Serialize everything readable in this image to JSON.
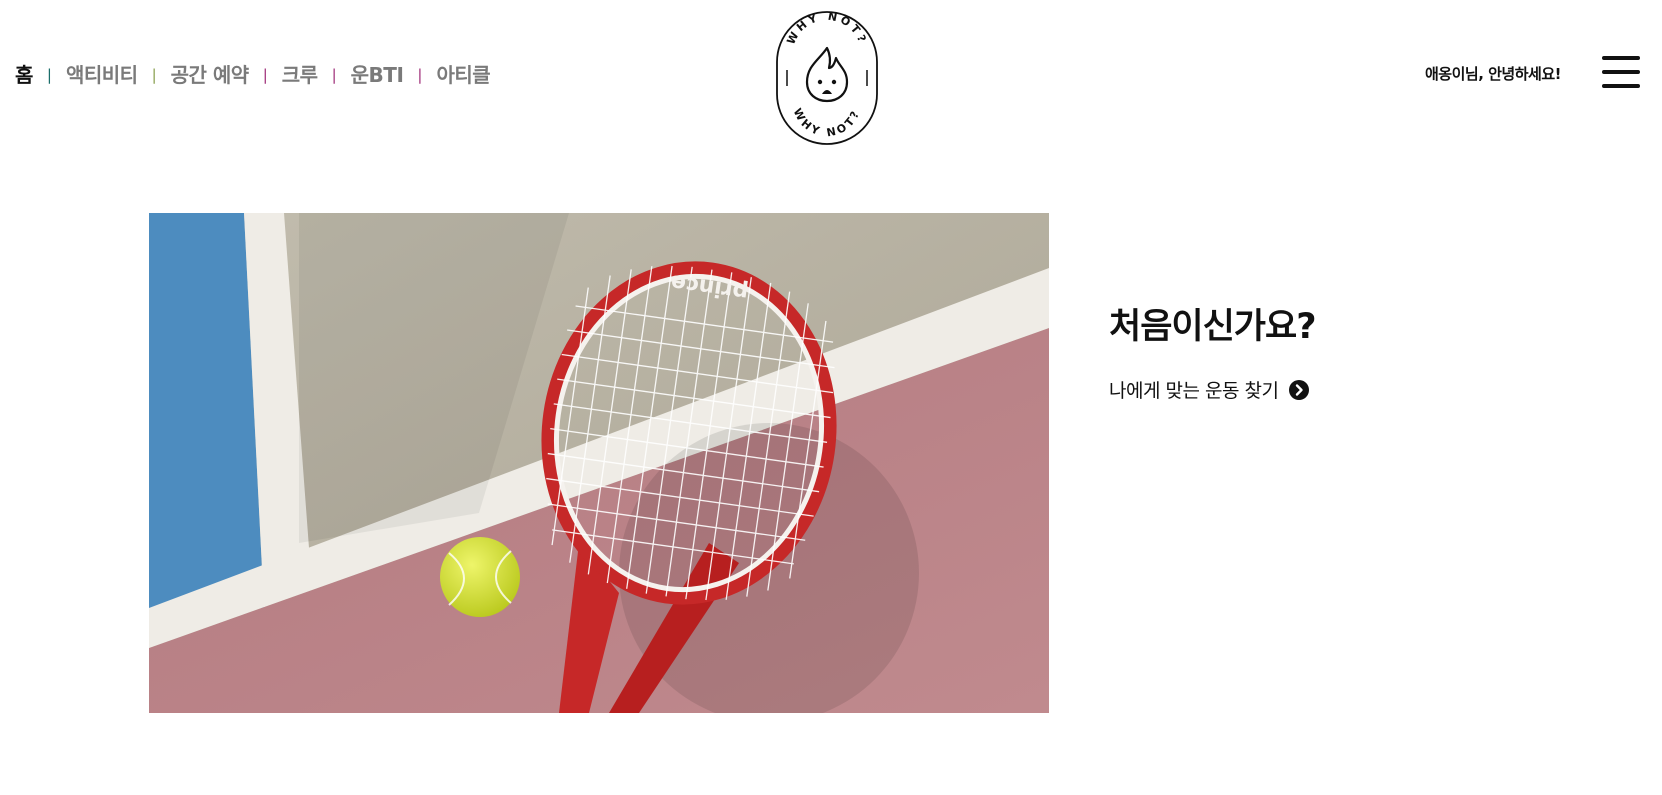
{
  "nav": {
    "items": [
      {
        "label": "홈",
        "active": true
      },
      {
        "label": "액티비티",
        "active": false
      },
      {
        "label": "공간 예약",
        "active": false
      },
      {
        "label": "크루",
        "active": false
      },
      {
        "label": "운BTI",
        "active": false
      },
      {
        "label": "아티클",
        "active": false
      }
    ],
    "separator": "|",
    "separator_colors": [
      "#1b6e6a",
      "#8aa050",
      "#a0307a",
      "#a0307a",
      "#a0307a"
    ]
  },
  "logo": {
    "text_top": "WHY NOT?",
    "text_bottom": "WHY NOT?",
    "icon": "flame-face-icon"
  },
  "header": {
    "greeting": "애옹이님, 안녕하세요!",
    "menu_icon": "hamburger-icon"
  },
  "hero": {
    "image": "tennis-racket-and-ball-on-court",
    "racket_brand": "prince",
    "cta_title": "처음이신가요?",
    "cta_link_label": "나에게 맞는 운동 찾기",
    "cta_icon": "chevron-right-circle-icon"
  },
  "colors": {
    "text": "#111111",
    "nav_inactive": "#7a7a7a",
    "court_blue": "#4e8fc0",
    "court_sand": "#b9b3a3",
    "court_clay": "#b57a80",
    "racket_red": "#c62828",
    "ball_yellow": "#d7e62a"
  }
}
